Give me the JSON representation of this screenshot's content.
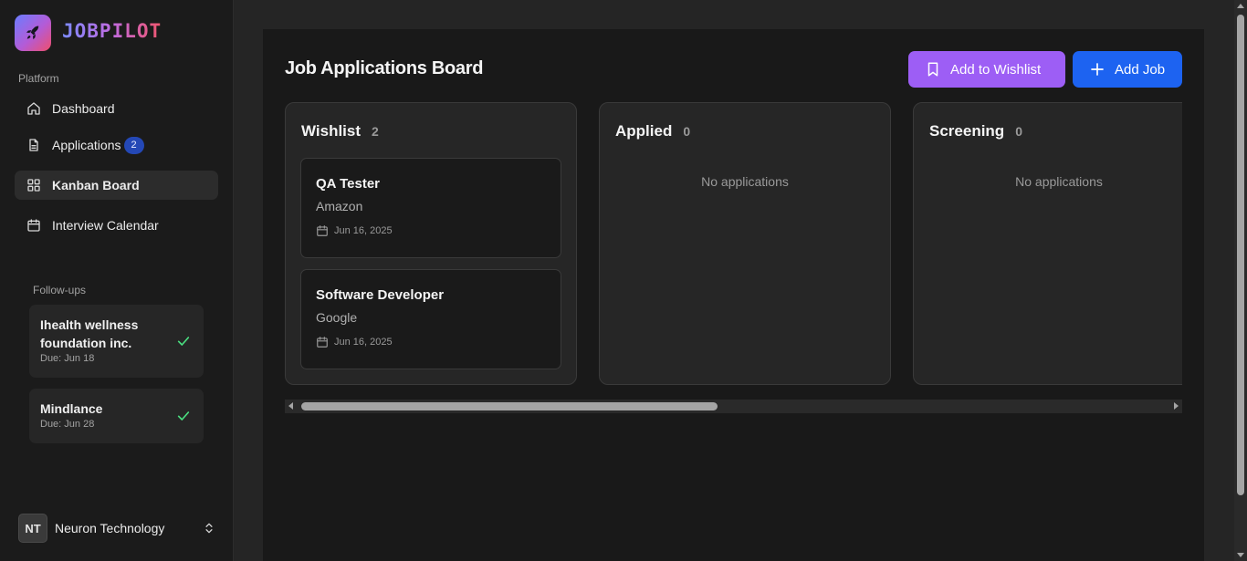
{
  "brand": {
    "name": "JOBPILOT",
    "icon": "rocket-icon"
  },
  "sidebar": {
    "section_label": "Platform",
    "items": [
      {
        "label": "Dashboard",
        "icon": "home-icon",
        "active": false
      },
      {
        "label": "Applications",
        "icon": "file-icon",
        "badge": "2",
        "active": false
      },
      {
        "label": "Kanban Board",
        "icon": "grid-icon",
        "active": true
      },
      {
        "label": "Interview Calendar",
        "icon": "calendar-icon",
        "active": false
      }
    ],
    "followups_label": "Follow-ups",
    "followups": [
      {
        "title": "Ihealth wellness foundation inc.",
        "due": "Due: Jun 18",
        "done": true
      },
      {
        "title": "Mindlance",
        "due": "Due: Jun 28",
        "done": true
      }
    ],
    "user": {
      "initials": "NT",
      "name": "Neuron Technology"
    }
  },
  "board": {
    "title": "Job Applications Board",
    "buttons": {
      "wishlist": "Add to Wishlist",
      "add_job": "Add Job"
    },
    "empty_text": "No applications",
    "columns": [
      {
        "title": "Wishlist",
        "count": "2",
        "cards": [
          {
            "title": "QA Tester",
            "company": "Amazon",
            "date": "Jun 16, 2025"
          },
          {
            "title": "Software Developer",
            "company": "Google",
            "date": "Jun 16, 2025"
          }
        ]
      },
      {
        "title": "Applied",
        "count": "0",
        "cards": []
      },
      {
        "title": "Screening",
        "count": "0",
        "cards": []
      }
    ]
  },
  "colors": {
    "accent_purple": "#9d5ef5",
    "accent_blue": "#1d63f1",
    "badge_blue": "#2448b6",
    "check_green": "#4ade80"
  }
}
